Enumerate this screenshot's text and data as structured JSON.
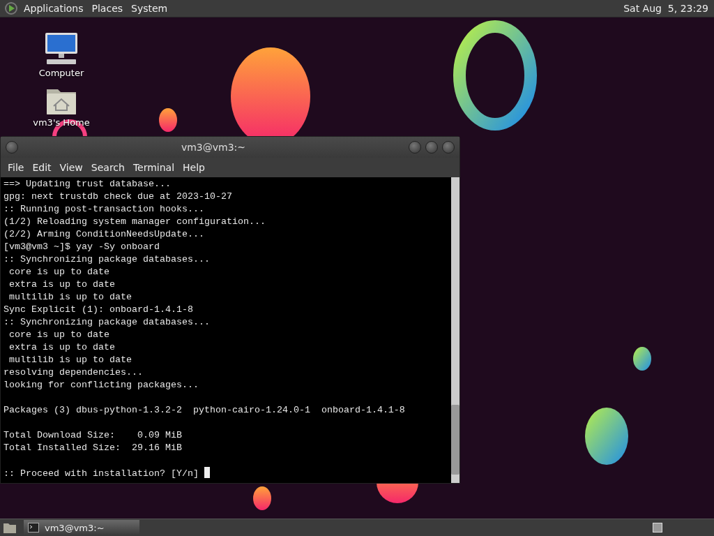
{
  "top_panel": {
    "menus": [
      "Applications",
      "Places",
      "System"
    ],
    "clock": "Sat Aug  5, 23:29"
  },
  "desktop_icons": [
    {
      "kind": "computer",
      "label": "Computer"
    },
    {
      "kind": "home",
      "label": "vm3's Home"
    }
  ],
  "window": {
    "title": "vm3@vm3:~",
    "menu": [
      "File",
      "Edit",
      "View",
      "Search",
      "Terminal",
      "Help"
    ],
    "blocks": [
      [
        "==> Updating trust database...",
        "gpg: next trustdb check due at 2023-10-27",
        ":: Running post-transaction hooks...",
        "(1/2) Reloading system manager configuration...",
        "(2/2) Arming ConditionNeedsUpdate...",
        "[vm3@vm3 ~]$ yay -Sy onboard",
        ":: Synchronizing package databases...",
        " core is up to date",
        " extra is up to date",
        " multilib is up to date",
        "Sync Explicit (1): onboard-1.4.1-8",
        ":: Synchronizing package databases...",
        " core is up to date",
        " extra is up to date",
        " multilib is up to date",
        "resolving dependencies...",
        "looking for conflicting packages..."
      ],
      [
        "Packages (3) dbus-python-1.3.2-2  python-cairo-1.24.0-1  onboard-1.4.1-8"
      ],
      [
        "Total Download Size:    0.09 MiB",
        "Total Installed Size:  29.16 MiB"
      ],
      [
        ":: Proceed with installation? [Y/n] "
      ]
    ]
  },
  "taskbar": {
    "tasks": [
      {
        "label": "vm3@vm3:~",
        "selected": true
      }
    ]
  }
}
